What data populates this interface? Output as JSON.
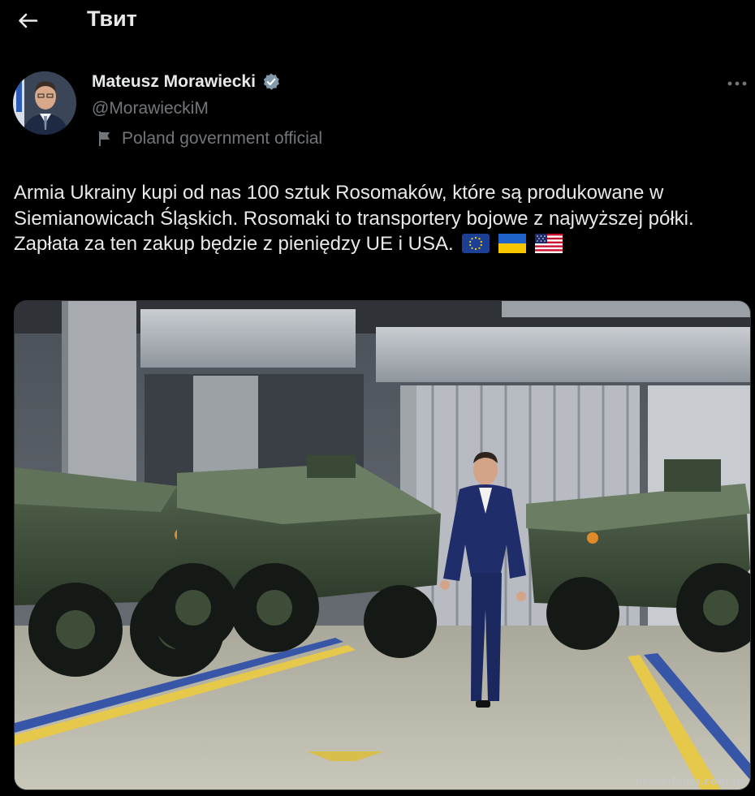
{
  "header": {
    "title": "Твит",
    "back_icon": "arrow-left-icon"
  },
  "author": {
    "name": "Mateusz Morawiecki",
    "handle": "@MorawieckiM",
    "verified": true,
    "verified_color": "#829aab",
    "affiliation": "Poland government official",
    "affiliation_icon": "flag-icon"
  },
  "tweet": {
    "lines": [
      "Armia Ukrainy kupi od nas 100 sztuk Rosomaków, które są produkowane w Siemianowicach Śląskich. Rosomaki to transportery bojowe z najwyższej półki.",
      "Zapłata za ten zakup będzie z pieniędzy UE i USA."
    ],
    "emojis": [
      "eu-flag-icon",
      "ukraine-flag-icon",
      "us-flag-icon"
    ]
  },
  "media": {
    "icon": "photo-armored-vehicles"
  },
  "watermark": "nevsedoma.com.ua",
  "colors": {
    "background": "#000000",
    "text": "#e7e9ea",
    "secondary": "#71767b"
  }
}
